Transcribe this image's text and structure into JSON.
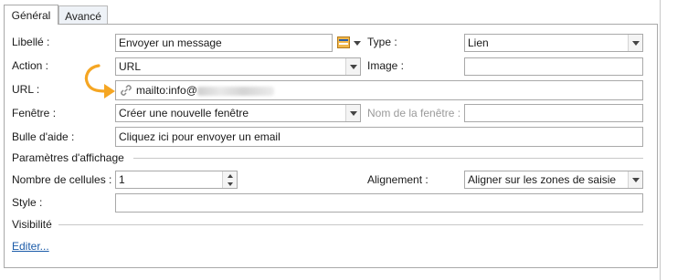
{
  "tabs": [
    {
      "label": "Général",
      "active": true
    },
    {
      "label": "Avancé",
      "active": false
    }
  ],
  "form": {
    "libelle_label": "Libellé :",
    "libelle_value": "Envoyer un message",
    "type_label": "Type :",
    "type_value": "Lien",
    "action_label": "Action :",
    "action_value": "URL",
    "image_label": "Image :",
    "image_value": "",
    "url_label": "URL :",
    "url_value": "mailto:info@",
    "fenetre_label": "Fenêtre :",
    "fenetre_value": "Créer une nouvelle fenêtre",
    "nom_fenetre_label": "Nom de la fenêtre :",
    "nom_fenetre_value": "",
    "bulle_label": "Bulle d'aide :",
    "bulle_value": "Cliquez ici pour envoyer un email"
  },
  "affichage": {
    "section_label": "Paramètres d'affichage",
    "cellules_label": "Nombre de cellules :",
    "cellules_value": "1",
    "alignement_label": "Alignement :",
    "alignement_value": "Aligner sur les zones de saisie",
    "style_label": "Style :",
    "style_value": ""
  },
  "visibilite": {
    "section_label": "Visibilité",
    "edit_link": "Editer..."
  },
  "icons": [
    "picker-icon",
    "link-icon",
    "curved-arrow-icon"
  ],
  "colors": {
    "accent_arrow": "#f5a623",
    "link": "#1a5aa8"
  }
}
